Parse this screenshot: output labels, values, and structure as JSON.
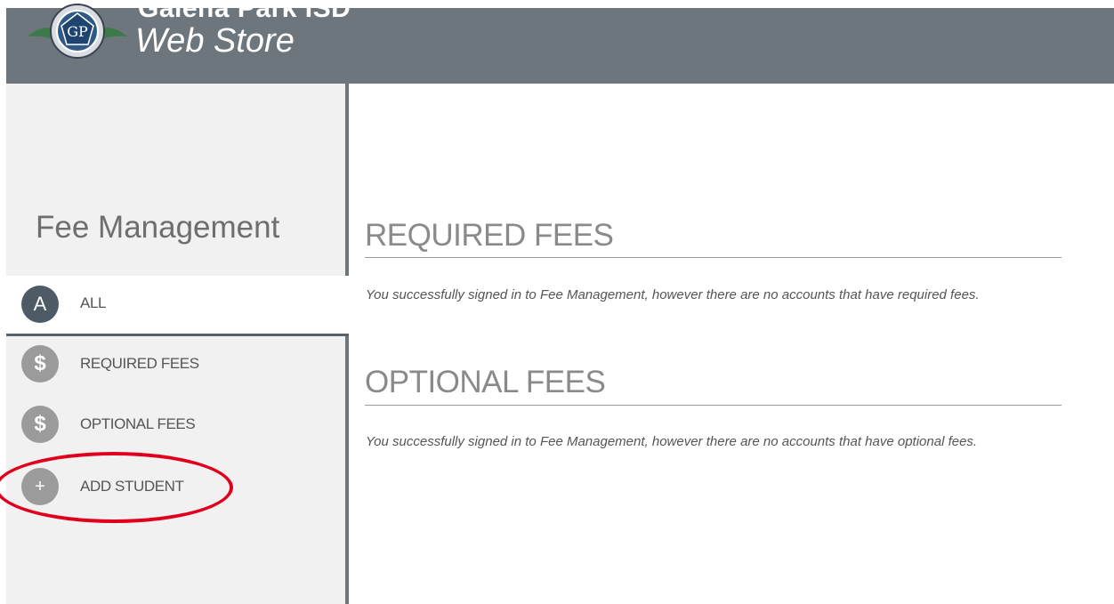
{
  "header": {
    "brand_name": "Galena Park ISD",
    "brand_subtitle": "Web Store",
    "logo_text": "GP"
  },
  "sidebar": {
    "title": "Fee Management",
    "items": [
      {
        "icon_text": "A",
        "label": "ALL",
        "active": true
      },
      {
        "icon_text": "$",
        "label": "REQUIRED FEES",
        "active": false
      },
      {
        "icon_text": "$",
        "label": "OPTIONAL FEES",
        "active": false
      },
      {
        "icon_text": "+",
        "label": "ADD STUDENT",
        "active": false
      }
    ]
  },
  "main": {
    "required": {
      "title": "REQUIRED FEES",
      "message": "You successfully signed in to Fee Management, however there are no accounts that have required fees."
    },
    "optional": {
      "title": "OPTIONAL FEES",
      "message": "You successfully signed in to Fee Management, however there are no accounts that have optional fees."
    }
  },
  "colors": {
    "header": "#6e767d",
    "sidebar": "#f1f1f1",
    "active_icon": "#4e5a66",
    "inactive_icon": "#9b9b9b",
    "annotation": "#e0001b"
  },
  "icons": [
    "district-logo-icon",
    "letter-a-icon",
    "dollar-icon",
    "plus-icon"
  ]
}
